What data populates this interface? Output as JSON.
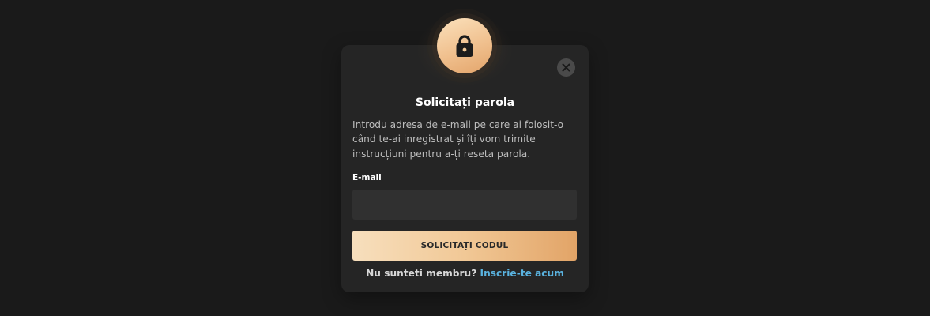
{
  "modal": {
    "title": "Solicitați parola",
    "description": "Introdu adresa de e-mail pe care ai folosit-o când te-ai inregistrat și îți vom trimite instrucțiuni pentru a-ți reseta parola.",
    "email_label": "E-mail",
    "email_value": "",
    "email_placeholder": "",
    "submit_label": "SOLICITAȚI CODUL",
    "signup_question": "Nu sunteti membru?",
    "signup_link": "Inscrie-te acum"
  },
  "icons": {
    "header": "lock-icon",
    "close": "close-icon"
  },
  "colors": {
    "background": "#1a1a1a",
    "modal_background": "#252525",
    "accent_gold": "#f1c896",
    "link": "#5ab3e0",
    "input_background": "#303030"
  }
}
